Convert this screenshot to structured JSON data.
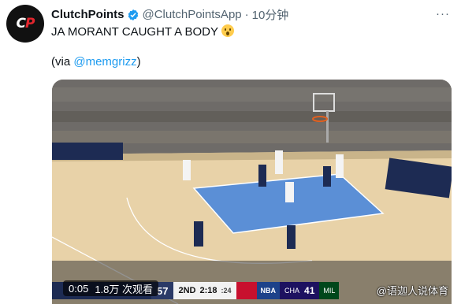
{
  "tweet": {
    "avatar_text_c": "C",
    "avatar_text_p": "P",
    "display_name": "ClutchPoints",
    "handle": "@ClutchPointsApp",
    "separator": "·",
    "time": "10分钟",
    "more": "···",
    "text": "JA MORANT CAUGHT A BODY",
    "via_prefix": "(via ",
    "via_link": "@memgrizz",
    "via_suffix": ")"
  },
  "video": {
    "elapsed": "0:05",
    "views": "1.8万 次观看",
    "watermark": "@语迦人说体育"
  },
  "scoreboard": {
    "mem_score": "57",
    "period": "2ND",
    "clock": "2:18",
    "shot_clock": ":24",
    "network": "NBA",
    "cha_label": "CHA",
    "cha_score": "41",
    "mil_label": "MIL"
  },
  "colors": {
    "link": "#1d9bf0",
    "verified": "#1d9bf0",
    "court_paint": "#5b8fd6",
    "court_wood": "#e8d2a8"
  }
}
